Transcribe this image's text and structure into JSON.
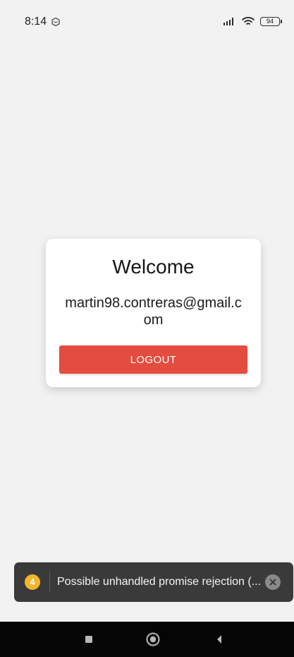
{
  "status_bar": {
    "time": "8:14",
    "battery": "94",
    "icons": [
      "notification-icon",
      "signal-icon",
      "wifi-icon",
      "battery-icon"
    ]
  },
  "card": {
    "title": "Welcome",
    "email": "martin98.contreras@gmail.com",
    "logout_label": "LOGOUT",
    "logout_color": "#e34c3f"
  },
  "toast": {
    "count": "4",
    "message": "Possible unhandled promise rejection (...",
    "count_color": "#f4b62a",
    "close_icon": "close-icon"
  },
  "nav": {
    "buttons": [
      "recent-apps-icon",
      "home-icon",
      "back-icon"
    ]
  }
}
